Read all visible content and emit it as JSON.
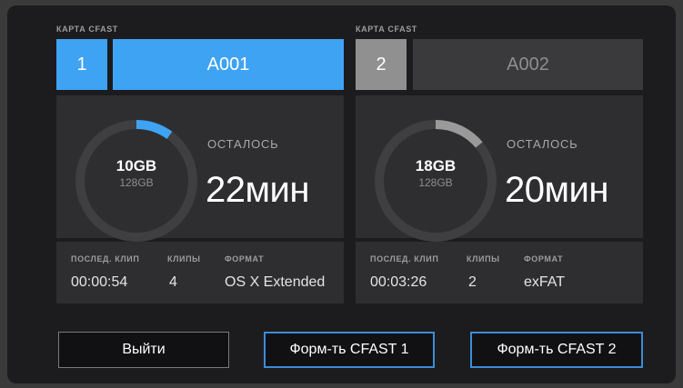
{
  "cards": [
    {
      "label": "КАРТА CFAST",
      "slot": "1",
      "clip_name": "A001",
      "active": true,
      "used": "10GB",
      "total": "128GB",
      "fill_fraction": 0.1,
      "remaining_label": "ОСТАЛОСЬ",
      "remaining_value": "22мин",
      "last_clip_label": "ПОСЛЕД. КЛИП",
      "last_clip": "00:00:54",
      "clips_label": "КЛИПЫ",
      "clips": "4",
      "format_label": "ФОРМАТ",
      "format": "OS X Extended"
    },
    {
      "label": "КАРТА CFAST",
      "slot": "2",
      "clip_name": "A002",
      "active": false,
      "used": "18GB",
      "total": "128GB",
      "fill_fraction": 0.14,
      "remaining_label": "ОСТАЛОСЬ",
      "remaining_value": "20мин",
      "last_clip_label": "ПОСЛЕД. КЛИП",
      "last_clip": "00:03:26",
      "clips_label": "КЛИПЫ",
      "clips": "2",
      "format_label": "ФОРМАТ",
      "format": "exFAT"
    }
  ],
  "buttons": {
    "exit": "Выйти",
    "format1": "Форм-ть CFAST 1",
    "format2": "Форм-ть CFAST 2"
  },
  "colors": {
    "active_accent": "#3fa3f4",
    "inactive_slot": "#909090",
    "inactive_name_bg": "#3a3a3c",
    "ring_track": "#3f3f41",
    "ring_fill_active": "#3fa3f4",
    "ring_fill_inactive": "#9a9a9a",
    "button_border_blue": "#3a8dd6",
    "button_border_gray": "#7a7a7a"
  }
}
